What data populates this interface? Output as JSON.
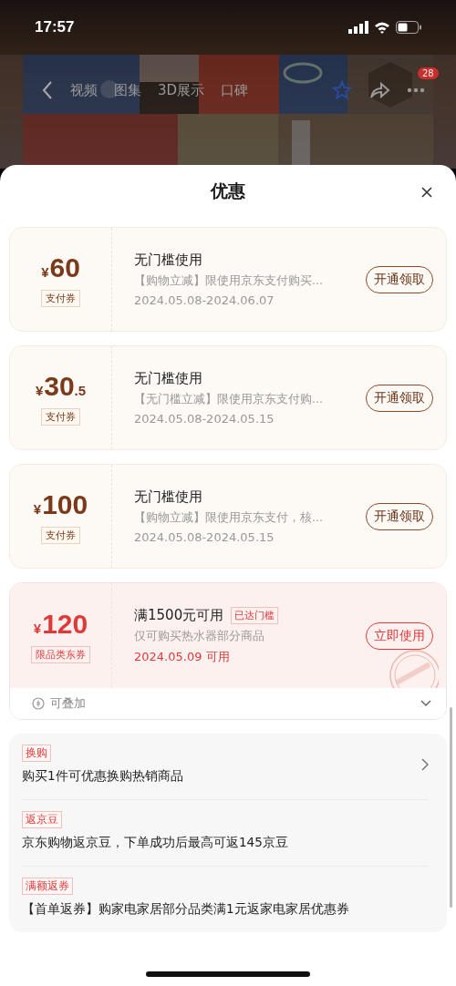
{
  "status_bar": {
    "time": "17:57"
  },
  "header": {
    "tabs": [
      "视频",
      "图集",
      "3D展示",
      "口碑"
    ],
    "more_badge": "28"
  },
  "sheet": {
    "title": "优惠",
    "coupons": [
      {
        "kind": "payment",
        "currency": "¥",
        "amount": "60",
        "tag": "支付券",
        "title": "无门槛使用",
        "desc": "【购物立减】限使用京东支付购买...",
        "date": "2024.05.08-2024.06.07",
        "button": "开通领取"
      },
      {
        "kind": "payment",
        "currency": "¥",
        "amount": "30",
        "fraction": ".5",
        "tag": "支付券",
        "title": "无门槛使用",
        "desc": "【无门槛立减】限使用京东支付购...",
        "date": "2024.05.08-2024.05.15",
        "button": "开通领取"
      },
      {
        "kind": "payment",
        "currency": "¥",
        "amount": "100",
        "tag": "支付券",
        "title": "无门槛使用",
        "desc": "【购物立减】限使用京东支付，核...",
        "date": "2024.05.08-2024.05.15",
        "button": "开通领取"
      },
      {
        "kind": "category",
        "currency": "¥",
        "amount": "120",
        "tag": "限品类东券",
        "title": "满1500元可用",
        "threshold_tag": "已达门槛",
        "desc": "仅可购买热水器部分商品",
        "date": "2024.05.09 可用",
        "button": "立即使用",
        "received": true,
        "stack": {
          "label": "可叠加",
          "expanded": false
        }
      }
    ],
    "promotions": [
      {
        "tag": "换购",
        "text": "购买1件可优惠换购热销商品",
        "link": true
      },
      {
        "tag": "返京豆",
        "text": "京东购物返京豆，下单成功后最高可返145京豆",
        "link": false
      },
      {
        "tag": "满额返券",
        "text": "【首单返券】购家电家居部分品类满1元返家电家居优惠券",
        "link": false
      }
    ]
  }
}
